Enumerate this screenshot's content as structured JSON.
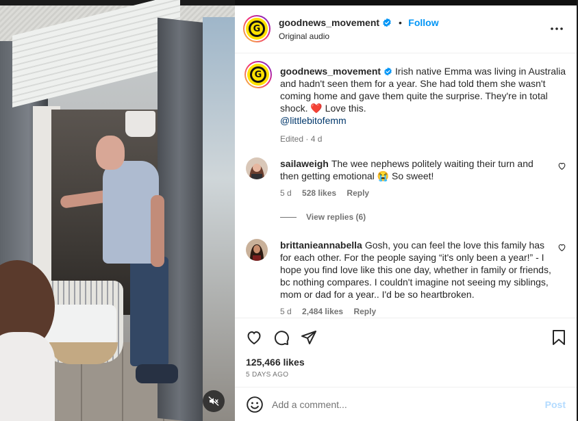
{
  "post": {
    "username": "goodnews_movement",
    "follow_label": "Follow",
    "separator": "•",
    "audio_label": "Original audio",
    "logo_letter": "G",
    "more_label": "More options"
  },
  "caption": {
    "username": "goodnews_movement",
    "text": "Irish native Emma was living in Australia and hadn't seen them for a year. She had told them she wasn't coming home and gave them quite the surprise. They're in total shock. ❤️ Love this.",
    "mention": "@littlebitofemm",
    "edited": "Edited · 4 d"
  },
  "comments": [
    {
      "username": "sailaweigh",
      "text": "The wee nephews politely waiting their turn and then getting emotional 😭 So sweet!",
      "age": "5 d",
      "likes": "528 likes",
      "reply": "Reply",
      "view_replies": "View replies (6)"
    },
    {
      "username": "brittanieannabella",
      "text": "Gosh, you can feel the love this family has for each other. For the people saying “it's only been a year!” - I hope you find love like this one day, whether in family or friends, bc nothing compares. I couldn't imagine not seeing my siblings, mom or dad for a year.. I'd be so heartbroken.",
      "age": "5 d",
      "likes": "2,484 likes",
      "reply": "Reply"
    }
  ],
  "actions": {
    "likes": "125,466 likes",
    "date": "5 DAYS AGO"
  },
  "add_comment": {
    "placeholder": "Add a comment...",
    "post_label": "Post"
  },
  "colors": {
    "accent": "#0095f6",
    "text": "#262626",
    "muted": "#737373",
    "logo_yellow": "#ffe100",
    "heart_red": "#ed4956"
  }
}
